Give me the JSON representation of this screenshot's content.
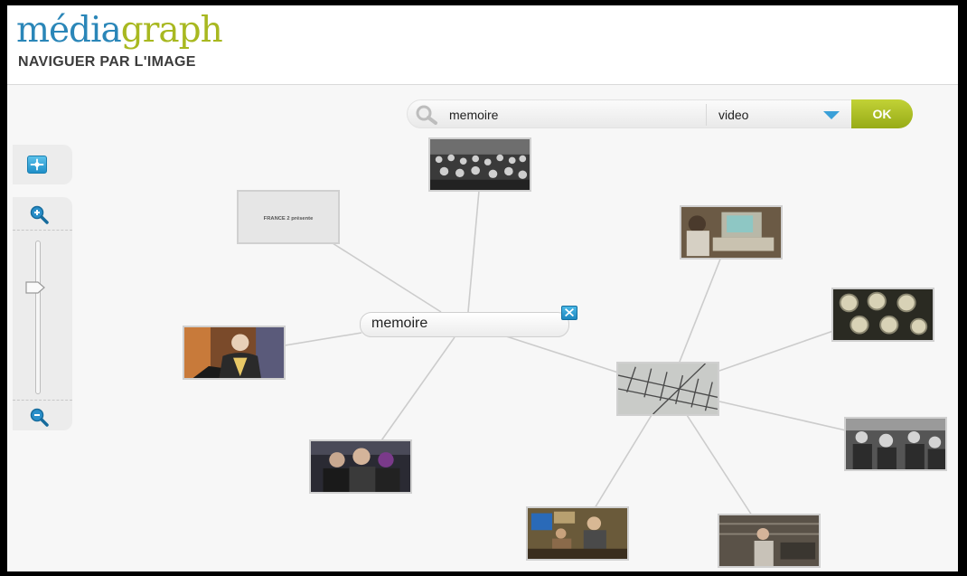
{
  "header": {
    "logo_part1": "média",
    "logo_part2": "graph",
    "subtitle": "NAVIGUER PAR L'IMAGE"
  },
  "search": {
    "query": "memoire",
    "type_value": "video",
    "ok_label": "OK"
  },
  "controls": {
    "zoom_level": 0.7
  },
  "graph": {
    "center_label": "memoire",
    "thumbnails": [
      {
        "name": "crowd-meeting"
      },
      {
        "name": "france2-presente-card",
        "caption": "FRANCE 2 présente"
      },
      {
        "name": "computer-terminal"
      },
      {
        "name": "film-reels"
      },
      {
        "name": "tv-interview"
      },
      {
        "name": "antenna-hub"
      },
      {
        "name": "crowd-street"
      },
      {
        "name": "archive-photo"
      },
      {
        "name": "lab-workers"
      },
      {
        "name": "workshop-man"
      }
    ]
  },
  "colors": {
    "brand_blue": "#2a86b8",
    "brand_green": "#a8b820",
    "ok_green": "#a7bb1f",
    "accent_blue": "#3aa0d8"
  }
}
